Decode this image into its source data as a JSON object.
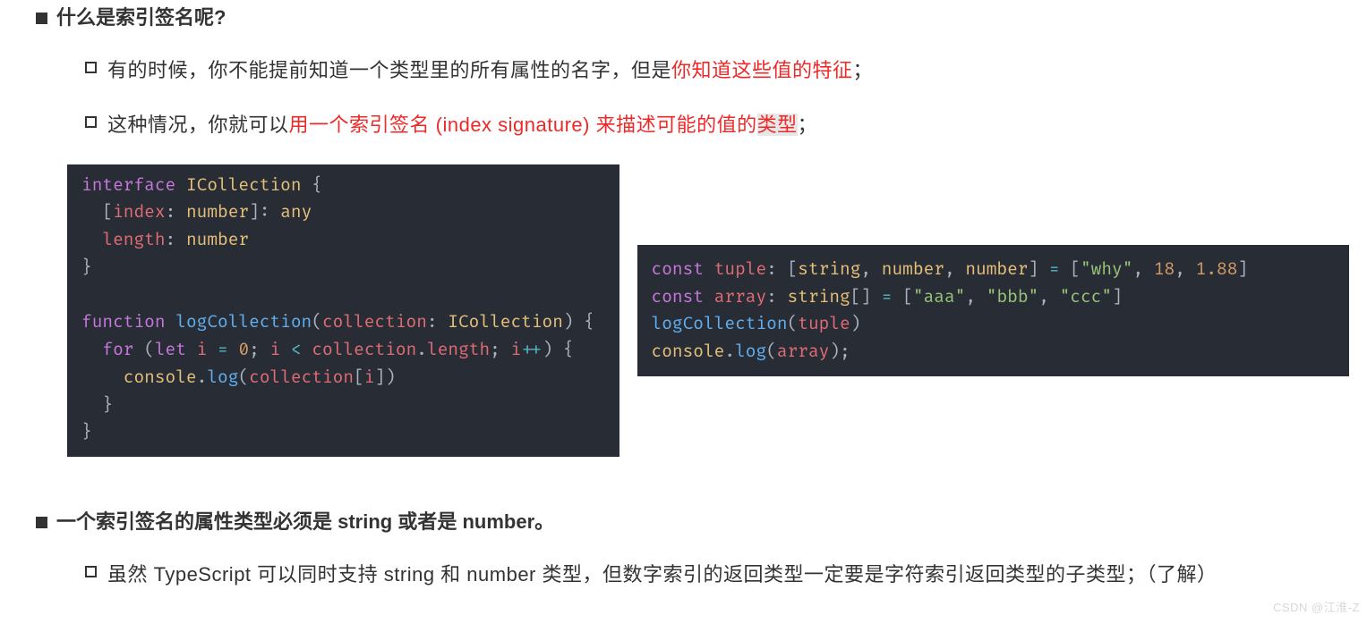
{
  "section1": {
    "heading": "什么是索引签名呢?",
    "bullets": [
      {
        "pre": "有的时候，你不能提前知道一个类型里的所有属性的名字，但是",
        "red": "你知道这些值的特征",
        "post": "；"
      },
      {
        "pre": "这种情况，你就可以",
        "red": "用一个索引签名 (index signature) 来描述可能的值的类型",
        "post": "；"
      }
    ]
  },
  "code_left": {
    "tokens": [
      [
        [
          "kw",
          "interface"
        ],
        [
          "punc",
          " "
        ],
        [
          "cls",
          "ICollection"
        ],
        [
          "punc",
          " {"
        ]
      ],
      [
        [
          "faint",
          "  "
        ],
        [
          "punc",
          "["
        ],
        [
          "prop",
          "index"
        ],
        [
          "punc",
          ": "
        ],
        [
          "type",
          "number"
        ],
        [
          "punc",
          "]: "
        ],
        [
          "type",
          "any"
        ]
      ],
      [
        [
          "faint",
          "  "
        ],
        [
          "prop",
          "length"
        ],
        [
          "punc",
          ": "
        ],
        [
          "type",
          "number"
        ]
      ],
      [
        [
          "punc",
          "}"
        ]
      ],
      [
        [
          "punc",
          ""
        ]
      ],
      [
        [
          "kw",
          "function"
        ],
        [
          "punc",
          " "
        ],
        [
          "fn",
          "logCollection"
        ],
        [
          "punc",
          "("
        ],
        [
          "param",
          "collection"
        ],
        [
          "punc",
          ": "
        ],
        [
          "cls",
          "ICollection"
        ],
        [
          "punc",
          ") {"
        ]
      ],
      [
        [
          "faint",
          "  "
        ],
        [
          "kw",
          "for"
        ],
        [
          "punc",
          " ("
        ],
        [
          "kw",
          "let"
        ],
        [
          "punc",
          " "
        ],
        [
          "var",
          "i"
        ],
        [
          "punc",
          " "
        ],
        [
          "op",
          "="
        ],
        [
          "punc",
          " "
        ],
        [
          "num",
          "0"
        ],
        [
          "punc",
          "; "
        ],
        [
          "var",
          "i"
        ],
        [
          "punc",
          " "
        ],
        [
          "op",
          "<"
        ],
        [
          "punc",
          " "
        ],
        [
          "var",
          "collection"
        ],
        [
          "punc",
          "."
        ],
        [
          "prop",
          "length"
        ],
        [
          "punc",
          "; "
        ],
        [
          "var",
          "i"
        ],
        [
          "op",
          "++"
        ],
        [
          "punc",
          ") {"
        ]
      ],
      [
        [
          "faint",
          "    "
        ],
        [
          "obj",
          "console"
        ],
        [
          "punc",
          "."
        ],
        [
          "fn",
          "log"
        ],
        [
          "punc",
          "("
        ],
        [
          "var",
          "collection"
        ],
        [
          "punc",
          "["
        ],
        [
          "var",
          "i"
        ],
        [
          "punc",
          "])"
        ]
      ],
      [
        [
          "faint",
          "  "
        ],
        [
          "punc",
          "}"
        ]
      ],
      [
        [
          "punc",
          "}"
        ]
      ]
    ]
  },
  "code_right": {
    "tokens": [
      [
        [
          "kw",
          "const"
        ],
        [
          "punc",
          " "
        ],
        [
          "var",
          "tuple"
        ],
        [
          "punc",
          ": ["
        ],
        [
          "type",
          "string"
        ],
        [
          "punc",
          ", "
        ],
        [
          "type",
          "number"
        ],
        [
          "punc",
          ", "
        ],
        [
          "type",
          "number"
        ],
        [
          "punc",
          "] "
        ],
        [
          "op",
          "="
        ],
        [
          "punc",
          " ["
        ],
        [
          "str",
          "\"why\""
        ],
        [
          "punc",
          ", "
        ],
        [
          "num",
          "18"
        ],
        [
          "punc",
          ", "
        ],
        [
          "num",
          "1.88"
        ],
        [
          "punc",
          "]"
        ]
      ],
      [
        [
          "kw",
          "const"
        ],
        [
          "punc",
          " "
        ],
        [
          "var",
          "array"
        ],
        [
          "punc",
          ": "
        ],
        [
          "type",
          "string"
        ],
        [
          "punc",
          "[] "
        ],
        [
          "op",
          "="
        ],
        [
          "punc",
          " ["
        ],
        [
          "str",
          "\"aaa\""
        ],
        [
          "punc",
          ", "
        ],
        [
          "str",
          "\"bbb\""
        ],
        [
          "punc",
          ", "
        ],
        [
          "str",
          "\"ccc\""
        ],
        [
          "punc",
          "]"
        ]
      ],
      [
        [
          "fn",
          "logCollection"
        ],
        [
          "punc",
          "("
        ],
        [
          "var",
          "tuple"
        ],
        [
          "punc",
          ")"
        ]
      ],
      [
        [
          "obj",
          "console"
        ],
        [
          "punc",
          "."
        ],
        [
          "fn",
          "log"
        ],
        [
          "punc",
          "("
        ],
        [
          "var",
          "array"
        ],
        [
          "punc",
          ");"
        ]
      ]
    ]
  },
  "section2": {
    "heading": "一个索引签名的属性类型必须是 string 或者是 number。",
    "bullets": [
      {
        "pre": "虽然 TypeScript 可以同时支持 string 和 number 类型，但数字索引的返回类型一定要是字符索引返回类型的子类型；（了解）",
        "red": "",
        "post": ""
      }
    ]
  },
  "watermark": "CSDN @江淮-Z"
}
